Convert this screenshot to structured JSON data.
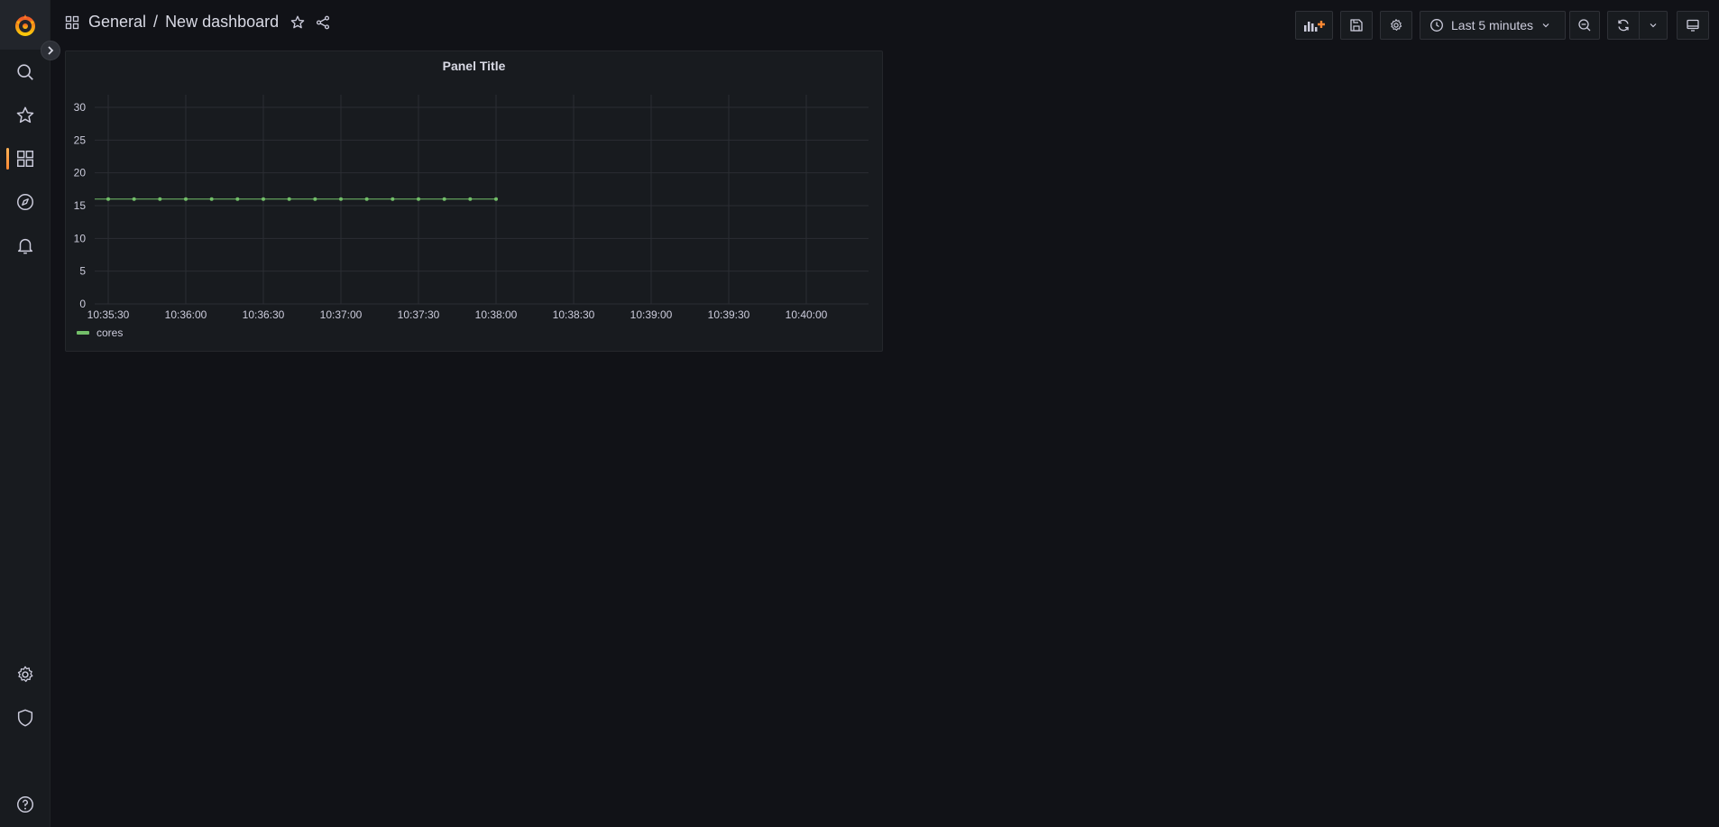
{
  "sidebar": {
    "items": [
      {
        "name": "search"
      },
      {
        "name": "starred"
      },
      {
        "name": "dashboards",
        "active": true
      },
      {
        "name": "explore"
      },
      {
        "name": "alerting"
      },
      {
        "name": "configuration"
      },
      {
        "name": "server-admin"
      },
      {
        "name": "help"
      }
    ],
    "accent": "#ff8833"
  },
  "header": {
    "folder": "General",
    "separator": "/",
    "title": "New dashboard"
  },
  "toolbar": {
    "time_range": "Last 5 minutes"
  },
  "panel": {
    "title": "Panel Title"
  },
  "chart_data": {
    "type": "line",
    "title": "Panel Title",
    "x": [
      "10:35:30",
      "10:35:40",
      "10:35:50",
      "10:36:00",
      "10:36:10",
      "10:36:20",
      "10:36:30",
      "10:36:40",
      "10:36:50",
      "10:37:00",
      "10:37:10",
      "10:37:20",
      "10:37:30",
      "10:37:40",
      "10:37:50",
      "10:38:00"
    ],
    "series": [
      {
        "name": "cores",
        "color": "#73bf69",
        "values": [
          16,
          16,
          16,
          16,
          16,
          16,
          16,
          16,
          16,
          16,
          16,
          16,
          16,
          16,
          16,
          16
        ]
      }
    ],
    "x_ticks": [
      "10:35:30",
      "10:36:00",
      "10:36:30",
      "10:37:00",
      "10:37:30",
      "10:38:00",
      "10:38:30",
      "10:39:00",
      "10:39:30",
      "10:40:00"
    ],
    "y_ticks": [
      0,
      5,
      10,
      15,
      20,
      25,
      30
    ],
    "ylim": [
      0,
      30
    ],
    "grid": true,
    "legend": "bottom-left"
  }
}
